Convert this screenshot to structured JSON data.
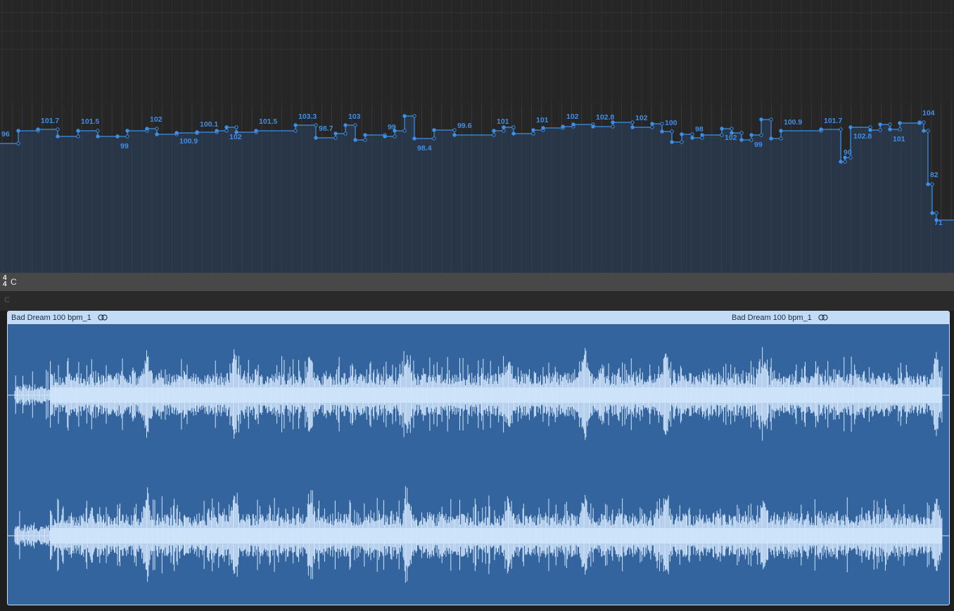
{
  "tempo_track": {
    "accent_color": "#3d8fe8",
    "labels": [
      "96",
      "101.7",
      "101.5",
      "99",
      "102",
      "100.9",
      "100.1",
      "102",
      "101.5",
      "103.3",
      "98.7",
      "103",
      "99",
      "98.4",
      "99.6",
      "101",
      "101",
      "102",
      "102.8",
      "102",
      "100",
      "98",
      "102",
      "99",
      "100.9",
      "101.7",
      "90",
      "102.8",
      "101",
      "104",
      "82",
      "71"
    ]
  },
  "signature_bar": {
    "time_signature_top": "4",
    "time_signature_bottom": "4",
    "key": "C"
  },
  "chord_track": {
    "chord": "C"
  },
  "audio_region": {
    "name": "Bad Dream 100 bpm_1",
    "name_repeat": "Bad Dream 100 bpm_1",
    "stereo_icon": "stereo-link-icon",
    "fill_color": "#33649e",
    "header_color": "#c3dcf6",
    "waveform_color": "#cfe4fb"
  }
}
